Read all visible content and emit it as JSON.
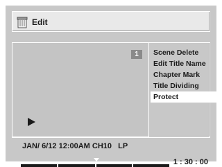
{
  "header": {
    "title": "Edit",
    "icon": "trash-can-icon"
  },
  "preview": {
    "title_number": "1",
    "play_icon": "play-icon"
  },
  "menu": {
    "items": [
      {
        "label": "Scene Delete"
      },
      {
        "label": "Edit Title Name"
      },
      {
        "label": "Chapter Mark"
      },
      {
        "label": "Title Dividing"
      },
      {
        "label": "Protect"
      }
    ],
    "selected_index": 4
  },
  "info": {
    "recording": "JAN/ 6/12 12:00AM CH10   LP",
    "duration": "1 : 30 : 00"
  },
  "colors": {
    "background": "#c8c8c8",
    "highlight": "#ffffff",
    "progress_bar": "#1a1a1a"
  }
}
